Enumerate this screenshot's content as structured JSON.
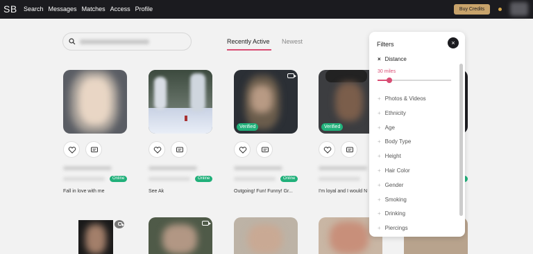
{
  "header": {
    "logo": "SB",
    "nav": [
      "Search",
      "Messages",
      "Matches",
      "Access",
      "Profile"
    ],
    "buy_credits": "Buy Credits"
  },
  "search": {
    "placeholder": ""
  },
  "tabs": {
    "active": "Recently Active",
    "newest": "Newest"
  },
  "cards": [
    {
      "verified": false,
      "online": "Online",
      "tagline": "Fall in love with me",
      "video": false
    },
    {
      "verified": false,
      "online": "Online",
      "tagline": "See Ak",
      "video": false
    },
    {
      "verified": true,
      "verified_label": "Verified",
      "online": "Online",
      "tagline": "Outgoing! Fun! Funny! Gr...",
      "video": true
    },
    {
      "verified": true,
      "verified_label": "Verified",
      "online": "",
      "tagline": "I'm loyal and I would N",
      "video": false
    }
  ],
  "filters": {
    "title": "Filters",
    "close": "×",
    "distance_label": "Distance",
    "distance_x": "×",
    "distance_value": "30 miles",
    "distance_fraction": 0.16,
    "items": [
      "Photos & Videos",
      "Ethnicity",
      "Age",
      "Body Type",
      "Height",
      "Hair Color",
      "Gender",
      "Smoking",
      "Drinking",
      "Piercings"
    ]
  },
  "colors": {
    "accent": "#d94c73",
    "verified": "#21b07a",
    "topbar": "#1b1b1f",
    "buy": "#c8a36b"
  }
}
